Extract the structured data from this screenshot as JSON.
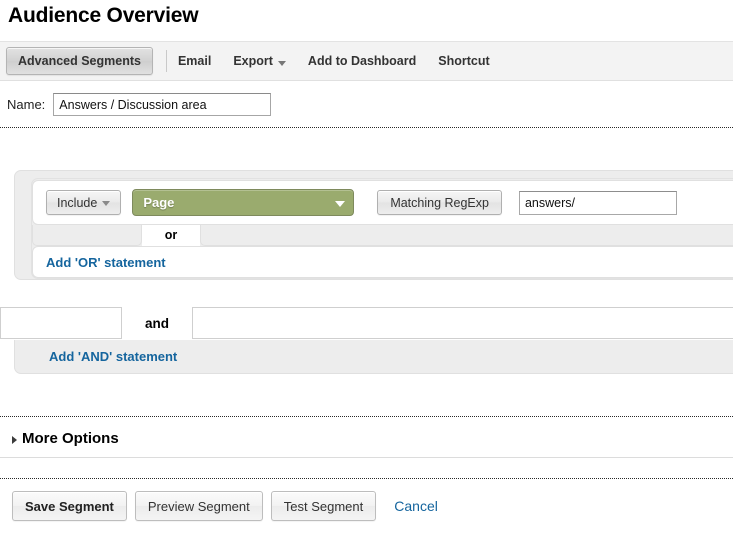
{
  "page": {
    "title": "Audience Overview"
  },
  "toolbar": {
    "advanced_segments_label": "Advanced Segments",
    "email_label": "Email",
    "export_label": "Export",
    "add_to_dashboard_label": "Add to Dashboard",
    "shortcut_label": "Shortcut"
  },
  "name_field": {
    "label": "Name:",
    "value": "Answers / Discussion area",
    "placeholder": ""
  },
  "segment_builder": {
    "condition": {
      "include_label": "Include",
      "dimension_label": "Page",
      "match_type_label": "Matching RegExp",
      "value": "answers/",
      "value_placeholder": ""
    },
    "or_separator_label": "or",
    "add_or_label": "Add 'OR' statement",
    "and_separator_label": "and",
    "add_and_label": "Add 'AND' statement",
    "dimension_accent_color": "#9aab6e",
    "link_color": "#15659e"
  },
  "more_options": {
    "label": "More Options",
    "expanded": false
  },
  "footer": {
    "save_label": "Save Segment",
    "preview_label": "Preview Segment",
    "test_label": "Test Segment",
    "cancel_label": "Cancel"
  }
}
